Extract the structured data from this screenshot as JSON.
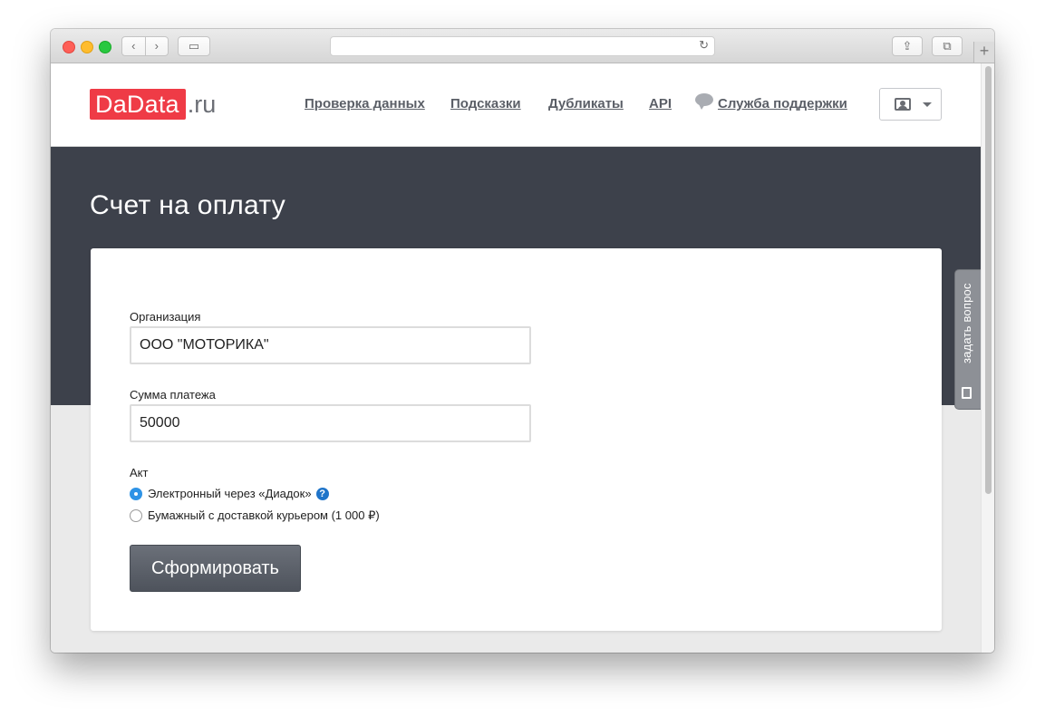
{
  "browser": {
    "url": "",
    "icons": {
      "back": "chevron-left-icon",
      "forward": "chevron-right-icon",
      "sidebar": "sidebar-icon",
      "reload": "reload-icon",
      "share": "share-icon",
      "tabs": "tabs-icon",
      "new_tab": "plus-icon"
    }
  },
  "header": {
    "logo_main": "DaData",
    "logo_tld": ".ru",
    "nav": [
      {
        "label": "Проверка данных"
      },
      {
        "label": "Подсказки"
      },
      {
        "label": "Дубликаты"
      },
      {
        "label": "API"
      },
      {
        "label": "Служба поддержки"
      }
    ]
  },
  "page": {
    "title": "Счет на оплату"
  },
  "form": {
    "org_label": "Организация",
    "org_value": "ООО \"МОТОРИКА\"",
    "amount_label": "Сумма платежа",
    "amount_value": "50000",
    "act_label": "Акт",
    "act_options": [
      {
        "label": "Электронный через «Диадок»",
        "checked": true
      },
      {
        "label": "Бумажный с доставкой курьером (1 000 ₽)",
        "checked": false
      }
    ],
    "help_glyph": "?",
    "submit_label": "Сформировать"
  },
  "feedback_tab": {
    "label": "задать вопрос"
  },
  "colors": {
    "brand_red": "#ef3b46",
    "hero_bg": "#3d414b",
    "radio_accent": "#2e93e6",
    "help_blue": "#1f74c9"
  }
}
